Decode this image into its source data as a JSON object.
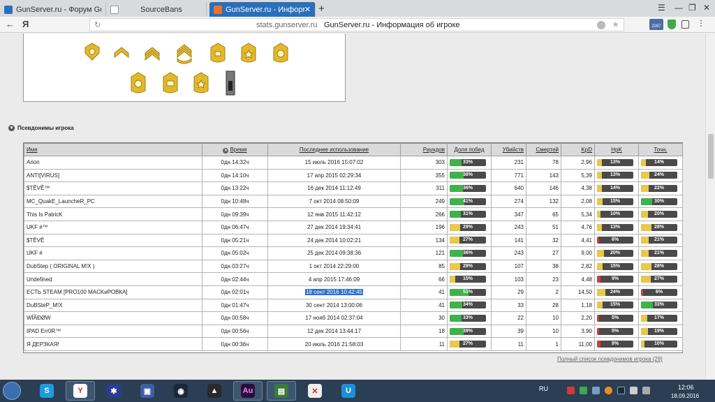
{
  "browser": {
    "tabs": [
      {
        "label": "GunServer.ru - Форум GunS",
        "active": false
      },
      {
        "label": "SourceBans",
        "active": false
      },
      {
        "label": "GunServer.ru - Информац",
        "active": true
      }
    ],
    "new_tab": "+",
    "window_controls": {
      "menu": "☰",
      "minimize": "—",
      "restore": "❐",
      "close": "✕"
    },
    "nav": {
      "back": "←",
      "brand": "Я"
    },
    "address": {
      "host": "stats.gunserver.ru",
      "title": "GunServer.ru - Информация об игроке"
    },
    "toolbar_badge": "2287"
  },
  "page": {
    "section_title": "Псевдонимы игрока",
    "columns": [
      "Имя",
      "Время",
      "Последнее использование",
      "Раундов",
      "Доля побед",
      "Убийств",
      "Смертей",
      "KpD",
      "HpK",
      "Точн."
    ],
    "rows": [
      {
        "name": "Arion",
        "time": "0дн 14:32ч",
        "last": "15 июль 2016 15:07:02",
        "rounds": "303",
        "win": 33,
        "kills": "231",
        "deaths": "78",
        "kpd": "2,96",
        "hpk": 13,
        "acc": 14,
        "highlight": false
      },
      {
        "name": "ANTI[VIRUS]",
        "time": "0дн 14:10ч",
        "last": "17 апр 2015 02:29:34",
        "rounds": "355",
        "win": 38,
        "kills": "771",
        "deaths": "143",
        "kpd": "5,39",
        "hpk": 13,
        "acc": 24,
        "highlight": false
      },
      {
        "name": "$TÊVÊ™",
        "time": "0дн 13:22ч",
        "last": "16 дек 2014 11:12:49",
        "rounds": "311",
        "win": 36,
        "kills": "640",
        "deaths": "146",
        "kpd": "4,38",
        "hpk": 14,
        "acc": 22,
        "highlight": false
      },
      {
        "name": "MC_QuakE_LauncheR_PC",
        "time": "0дн 10:48ч",
        "last": "7 окт 2014 08:50:09",
        "rounds": "249",
        "win": 41,
        "kills": "274",
        "deaths": "132",
        "kpd": "2,08",
        "hpk": 15,
        "acc": 30,
        "highlight": false
      },
      {
        "name": "This Is PatricK",
        "time": "0дн 09:39ч",
        "last": "12 янв 2015 11:42:12",
        "rounds": "266",
        "win": 31,
        "kills": "347",
        "deaths": "65",
        "kpd": "5,34",
        "hpk": 10,
        "acc": 20,
        "highlight": false
      },
      {
        "name": "UKF #™",
        "time": "0дн 06:47ч",
        "last": "27 дек 2014 19:34:41",
        "rounds": "196",
        "win": 29,
        "kills": "243",
        "deaths": "51",
        "kpd": "4,76",
        "hpk": 13,
        "acc": 28,
        "highlight": false
      },
      {
        "name": "$TÊVÊ",
        "time": "0дн 05:21ч",
        "last": "24 дек 2014 10:02:21",
        "rounds": "134",
        "win": 27,
        "kills": "141",
        "deaths": "32",
        "kpd": "4,41",
        "hpk": 6,
        "acc": 21,
        "highlight": false
      },
      {
        "name": "UKF #",
        "time": "0дн 05:02ч",
        "last": "25 дек 2014 09:38:36",
        "rounds": "121",
        "win": 36,
        "kills": "243",
        "deaths": "27",
        "kpd": "9,00",
        "hpk": 20,
        "acc": 21,
        "highlight": false
      },
      {
        "name": "DubStep ( ORIGINAL M!X )",
        "time": "0дн 03:27ч",
        "last": "1 окт 2014 22:29:00",
        "rounds": "85",
        "win": 28,
        "kills": "107",
        "deaths": "38",
        "kpd": "2,82",
        "hpk": 15,
        "acc": 28,
        "highlight": false
      },
      {
        "name": "Undefined",
        "time": "0дн 02:44ч",
        "last": "4 апр 2015 17:46:09",
        "rounds": "66",
        "win": 15,
        "kills": "103",
        "deaths": "23",
        "kpd": "4,48",
        "hpk": 9,
        "acc": 27,
        "highlight": false
      },
      {
        "name": "ЕСТЬ STEAM [PRO100 MACKиРОВКА]",
        "time": "0дн 02:01ч",
        "last": "18 сент 2016 10:42:45",
        "rounds": "41",
        "win": 51,
        "kills": "29",
        "deaths": "2",
        "kpd": "14,50",
        "hpk": 24,
        "acc": 6,
        "highlight": true
      },
      {
        "name": "DuBSteP_M!X",
        "time": "0дн 01:47ч",
        "last": "30 сент 2014 13:00:06",
        "rounds": "41",
        "win": 34,
        "kills": "33",
        "deaths": "28",
        "kpd": "1,18",
        "hpk": 15,
        "acc": 33,
        "highlight": false
      },
      {
        "name": "WÎÃÐØW͏",
        "time": "0дн 00:58ч",
        "last": "17 нояб 2014 02:37:04",
        "rounds": "30",
        "win": 33,
        "kills": "22",
        "deaths": "10",
        "kpd": "2,20",
        "hpk": 5,
        "acc": 17,
        "highlight": false
      },
      {
        "name": "IPAD Err0R™",
        "time": "0дн 00:56ч",
        "last": "12 дек 2014 13:44:17",
        "rounds": "18",
        "win": 39,
        "kills": "39",
        "deaths": "10",
        "kpd": "3,90",
        "hpk": 5,
        "acc": 19,
        "highlight": false
      },
      {
        "name": "Я ДЕРЗКАЯ!",
        "time": "0дн 00:36ч",
        "last": "20 июль 2016 21:58:03",
        "rounds": "11",
        "win": 27,
        "kills": "11",
        "deaths": "1",
        "kpd": "11,00",
        "hpk": 9,
        "acc": 10,
        "highlight": false
      }
    ],
    "full_list_link": "Полный список псевдонимов игрока (29)"
  },
  "colors": {
    "green": "#3fb24a",
    "yellow": "#e9c84a",
    "red": "#d33a3a"
  },
  "taskbar": {
    "apps": [
      "skype-icon",
      "yandex-browser-icon",
      "game-icon",
      "save-icon",
      "steam-icon",
      "avast-icon",
      "audition-icon",
      "terminal-icon",
      "opera-icon",
      "uplay-icon"
    ],
    "lang": "RU",
    "time": "12:06",
    "date": "18.09.2016"
  }
}
